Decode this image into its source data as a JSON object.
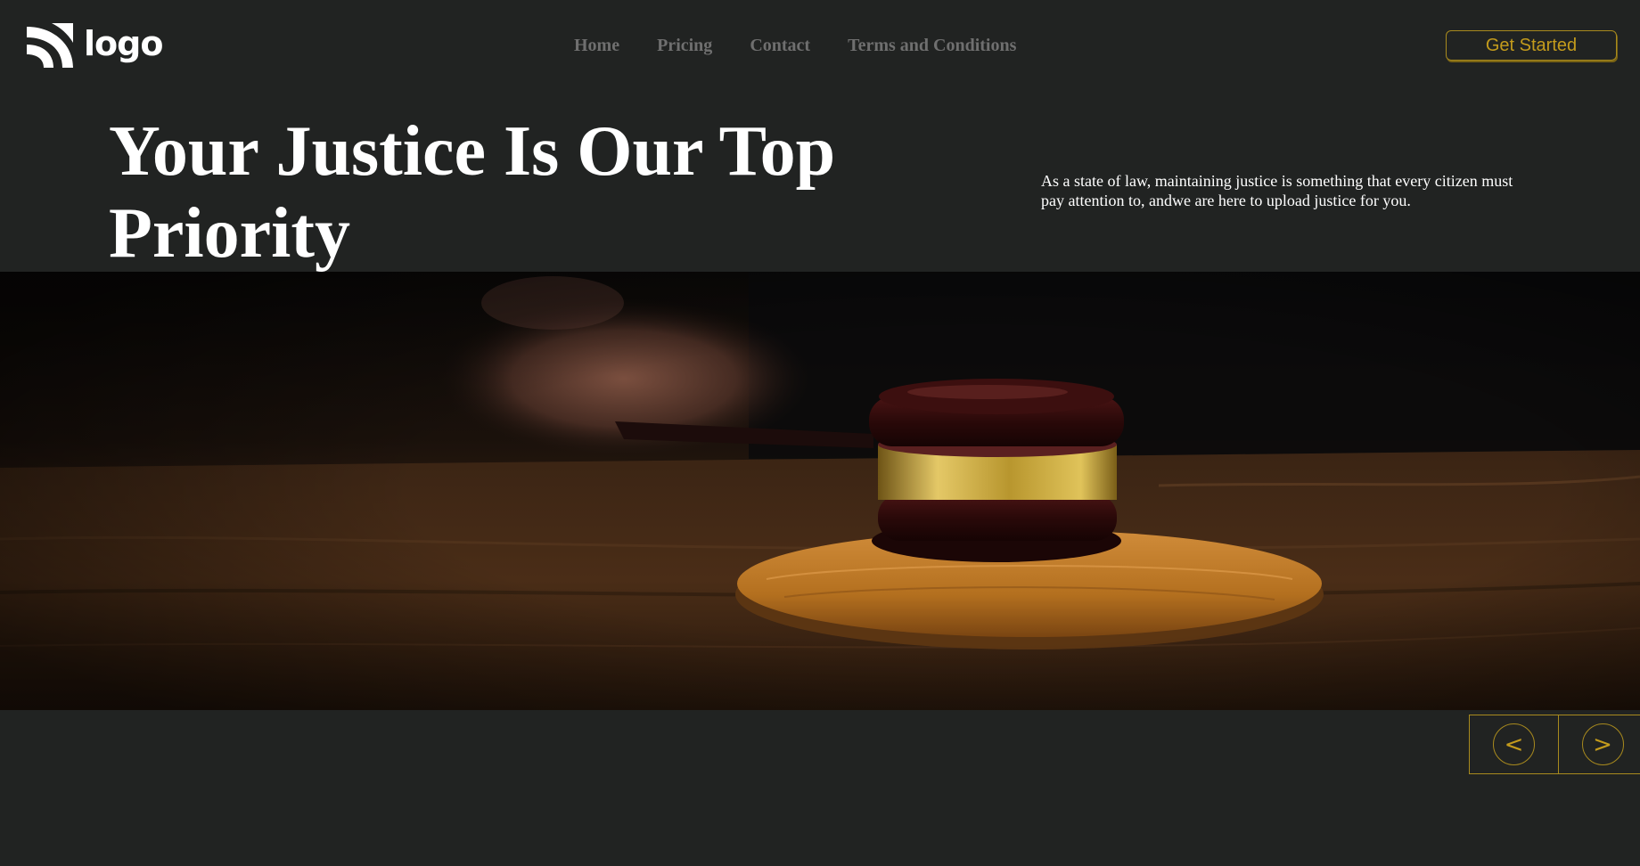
{
  "header": {
    "logo_text": "logo",
    "logo_icon": "logo-arcs-icon",
    "nav": [
      {
        "label": "Home"
      },
      {
        "label": "Pricing"
      },
      {
        "label": "Contact"
      },
      {
        "label": "Terms and Conditions"
      }
    ],
    "cta_label": "Get Started"
  },
  "hero": {
    "title": "Your Justice Is Our Top Priority",
    "description": "As a state of law, maintaining justice is something that every citizen must pay attention to, andwe are here to upload justice for you.",
    "image_subject": "gavel-on-sound-block"
  },
  "slider": {
    "prev_label": "<",
    "next_label": ">"
  },
  "colors": {
    "background": "#212322",
    "accent_gold": "#c39b1c",
    "nav_text": "#6f6f6f",
    "heading_text": "#ffffff"
  }
}
